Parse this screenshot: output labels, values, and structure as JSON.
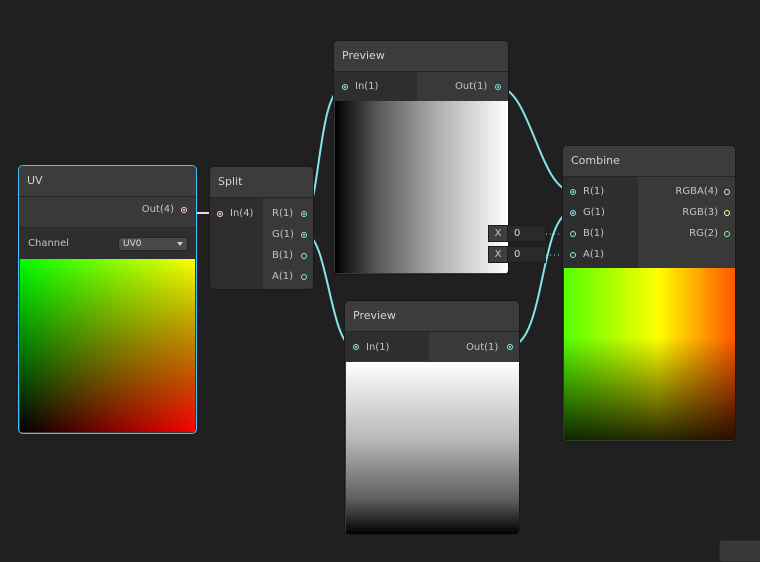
{
  "nodes": {
    "uv": {
      "title": "UV",
      "out_label": "Out(4)",
      "channel_label": "Channel",
      "channel_value": "UV0"
    },
    "split": {
      "title": "Split",
      "in_label": "In(4)",
      "outs": [
        "R(1)",
        "G(1)",
        "B(1)",
        "A(1)"
      ]
    },
    "preview_top": {
      "title": "Preview",
      "in_label": "In(1)",
      "out_label": "Out(1)"
    },
    "preview_bottom": {
      "title": "Preview",
      "in_label": "In(1)",
      "out_label": "Out(1)"
    },
    "combine": {
      "title": "Combine",
      "ins": [
        "R(1)",
        "G(1)",
        "B(1)",
        "A(1)"
      ],
      "outs": [
        "RGBA(4)",
        "RGB(3)",
        "RG(2)"
      ]
    }
  },
  "inline_fields": [
    {
      "label": "X",
      "value": "0"
    },
    {
      "label": "X",
      "value": "0"
    }
  ],
  "colors": {
    "background": "#202020",
    "wire": "#84e4e7",
    "wire_vec4": "#fbcbf4",
    "port_float": "#84e4e7",
    "port_vec4": "#fbcbf4",
    "port_vec3": "#f6ff9a",
    "port_vec2": "#9aef92",
    "selection": "#44c0ff"
  }
}
